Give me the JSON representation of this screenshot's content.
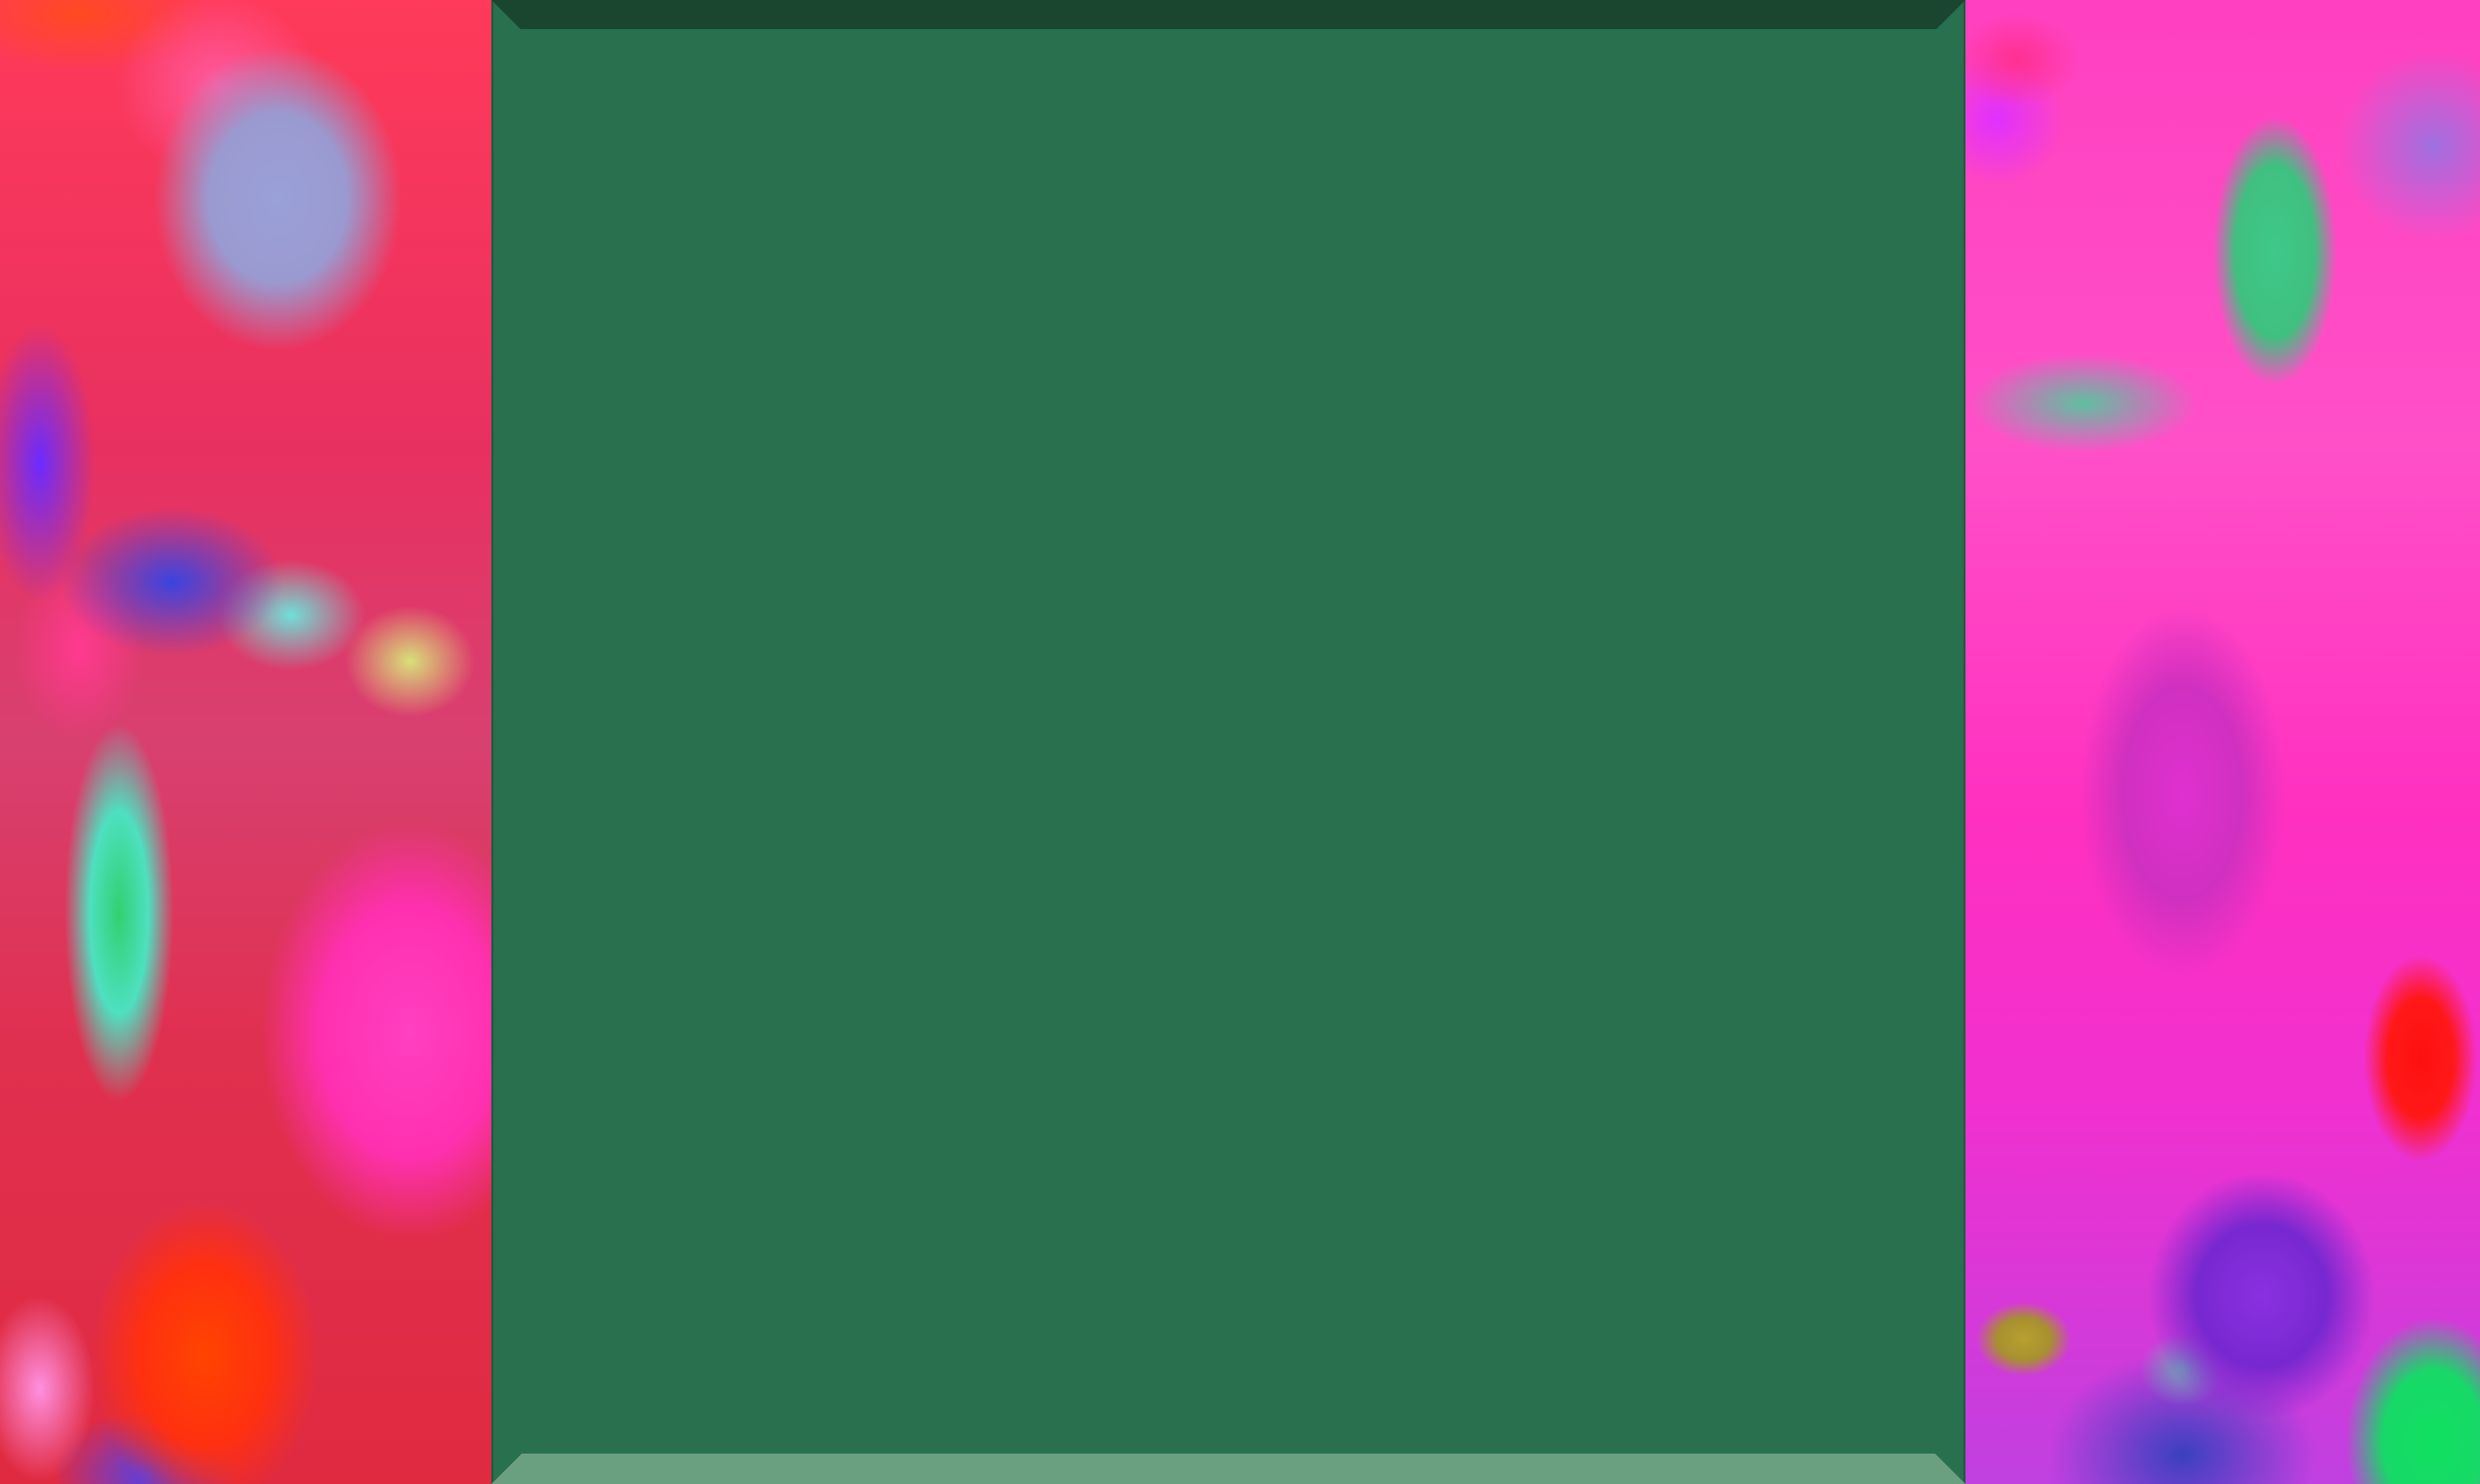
{
  "theme": {
    "window_fill": "#28704e",
    "top_bevel": "#1a4630",
    "bottom_bevel": "#6aa080",
    "wallpaper_left_base": "#e83060",
    "wallpaper_right_base": "#ff40c0"
  },
  "window": {
    "content": []
  }
}
